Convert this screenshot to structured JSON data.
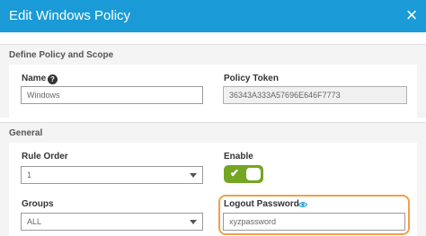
{
  "dialog": {
    "title": "Edit Windows Policy",
    "close_label": "×"
  },
  "define_section": {
    "title": "Define Policy and Scope",
    "name_label": "Name",
    "name_value": "Windows",
    "token_label": "Policy Token",
    "token_value": "36343A333A57696E646F7773"
  },
  "general_section": {
    "title": "General",
    "rule_order_label": "Rule Order",
    "rule_order_value": "1",
    "enable_label": "Enable",
    "enable_state": "on",
    "groups_label": "Groups",
    "groups_value": "ALL",
    "logout_password_label": "Logout Password",
    "logout_password_value": "xyzpassword"
  },
  "colors": {
    "header": "#1a9ad6",
    "toggle_on": "#74a624",
    "highlight": "#f0a04a",
    "eye_icon": "#1a9ad6"
  },
  "icons": {
    "help": "help-circle-icon",
    "eye": "eye-icon",
    "check": "check-icon"
  }
}
